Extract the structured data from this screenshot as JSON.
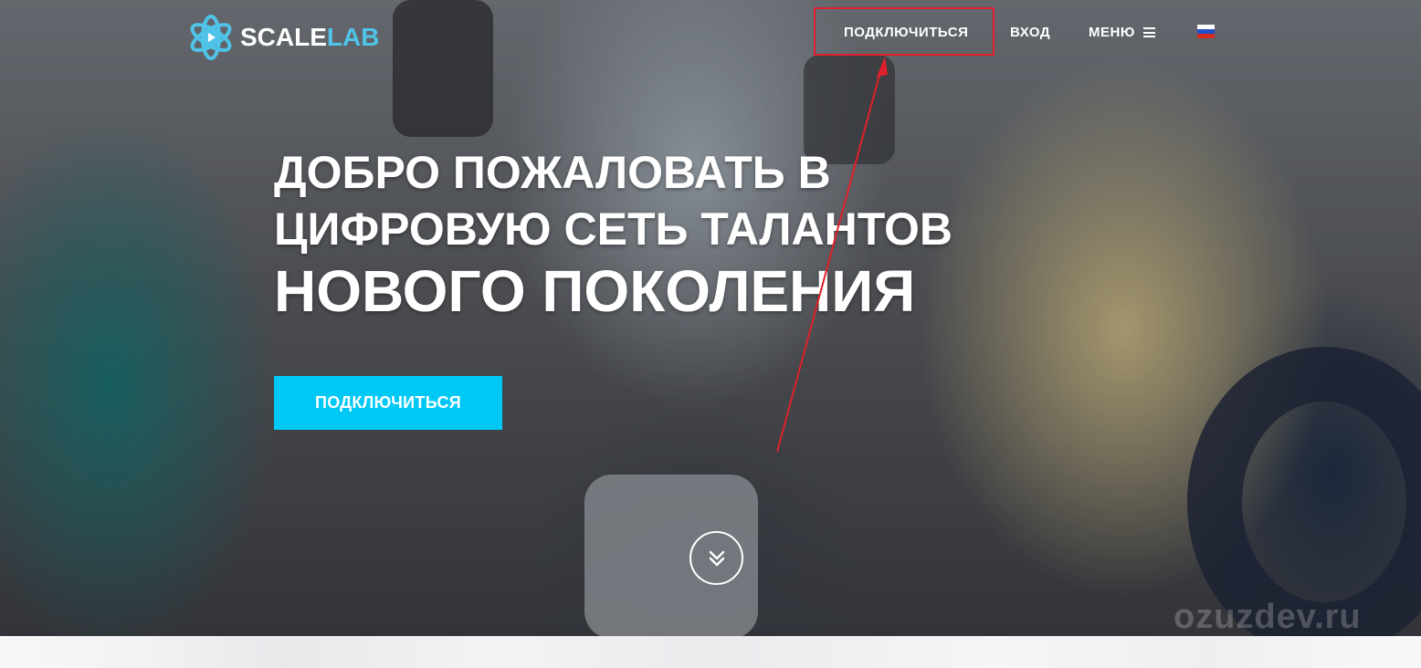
{
  "brand": {
    "name_part1": "SCALE",
    "name_part2": "LAB",
    "accent_color": "#4fc3e8",
    "icon": "atom-play-icon"
  },
  "nav": {
    "connect_label": "ПОДКЛЮЧИТЬСЯ",
    "login_label": "ВХОД",
    "menu_label": "МЕНЮ",
    "menu_icon": "hamburger-icon",
    "language_icon": "russian-flag-icon"
  },
  "hero": {
    "headline_line1": "ДОБРО ПОЖАЛОВАТЬ В",
    "headline_line2": "ЦИФРОВУЮ СЕТЬ ТАЛАНТОВ",
    "headline_line3": "НОВОГО ПОКОЛЕНИЯ",
    "cta_label": "ПОДКЛЮЧИТЬСЯ",
    "cta_color": "#00c8f5",
    "scroll_icon": "double-chevron-down-icon"
  },
  "annotation": {
    "highlight_color": "#e0202a"
  },
  "watermark": {
    "text": "ozuzdev.ru"
  }
}
